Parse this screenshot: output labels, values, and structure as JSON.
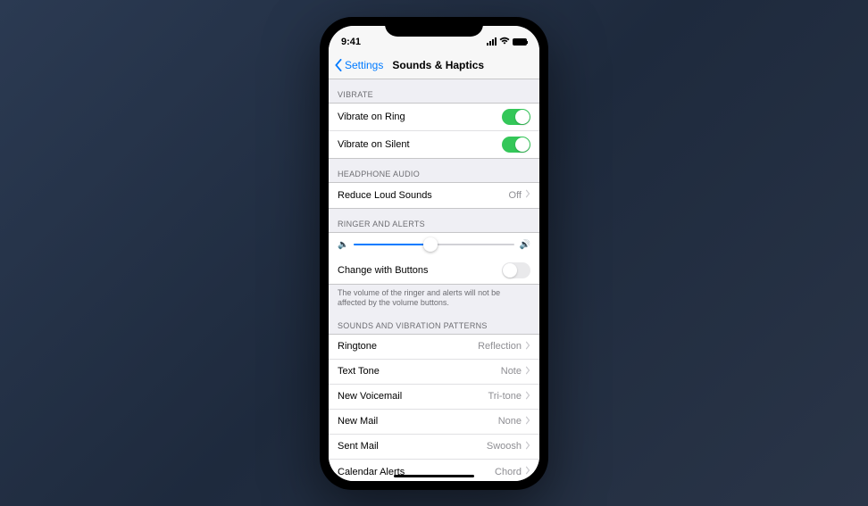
{
  "status": {
    "time": "9:41"
  },
  "nav": {
    "back": "Settings",
    "title": "Sounds & Haptics"
  },
  "sections": {
    "vibrate": {
      "header": "VIBRATE",
      "vibrateOnRing": {
        "label": "Vibrate on Ring",
        "on": true
      },
      "vibrateOnSilent": {
        "label": "Vibrate on Silent",
        "on": true
      }
    },
    "headphone": {
      "header": "HEADPHONE AUDIO",
      "reduceLoud": {
        "label": "Reduce Loud Sounds",
        "value": "Off"
      }
    },
    "ringer": {
      "header": "RINGER AND ALERTS",
      "sliderPercent": 48,
      "changeWithButtons": {
        "label": "Change with Buttons",
        "on": false
      },
      "footer": "The volume of the ringer and alerts will not be affected by the volume buttons."
    },
    "sounds": {
      "header": "SOUNDS AND VIBRATION PATTERNS",
      "items": [
        {
          "label": "Ringtone",
          "value": "Reflection"
        },
        {
          "label": "Text Tone",
          "value": "Note"
        },
        {
          "label": "New Voicemail",
          "value": "Tri-tone"
        },
        {
          "label": "New Mail",
          "value": "None"
        },
        {
          "label": "Sent Mail",
          "value": "Swoosh"
        },
        {
          "label": "Calendar Alerts",
          "value": "Chord"
        }
      ]
    }
  }
}
